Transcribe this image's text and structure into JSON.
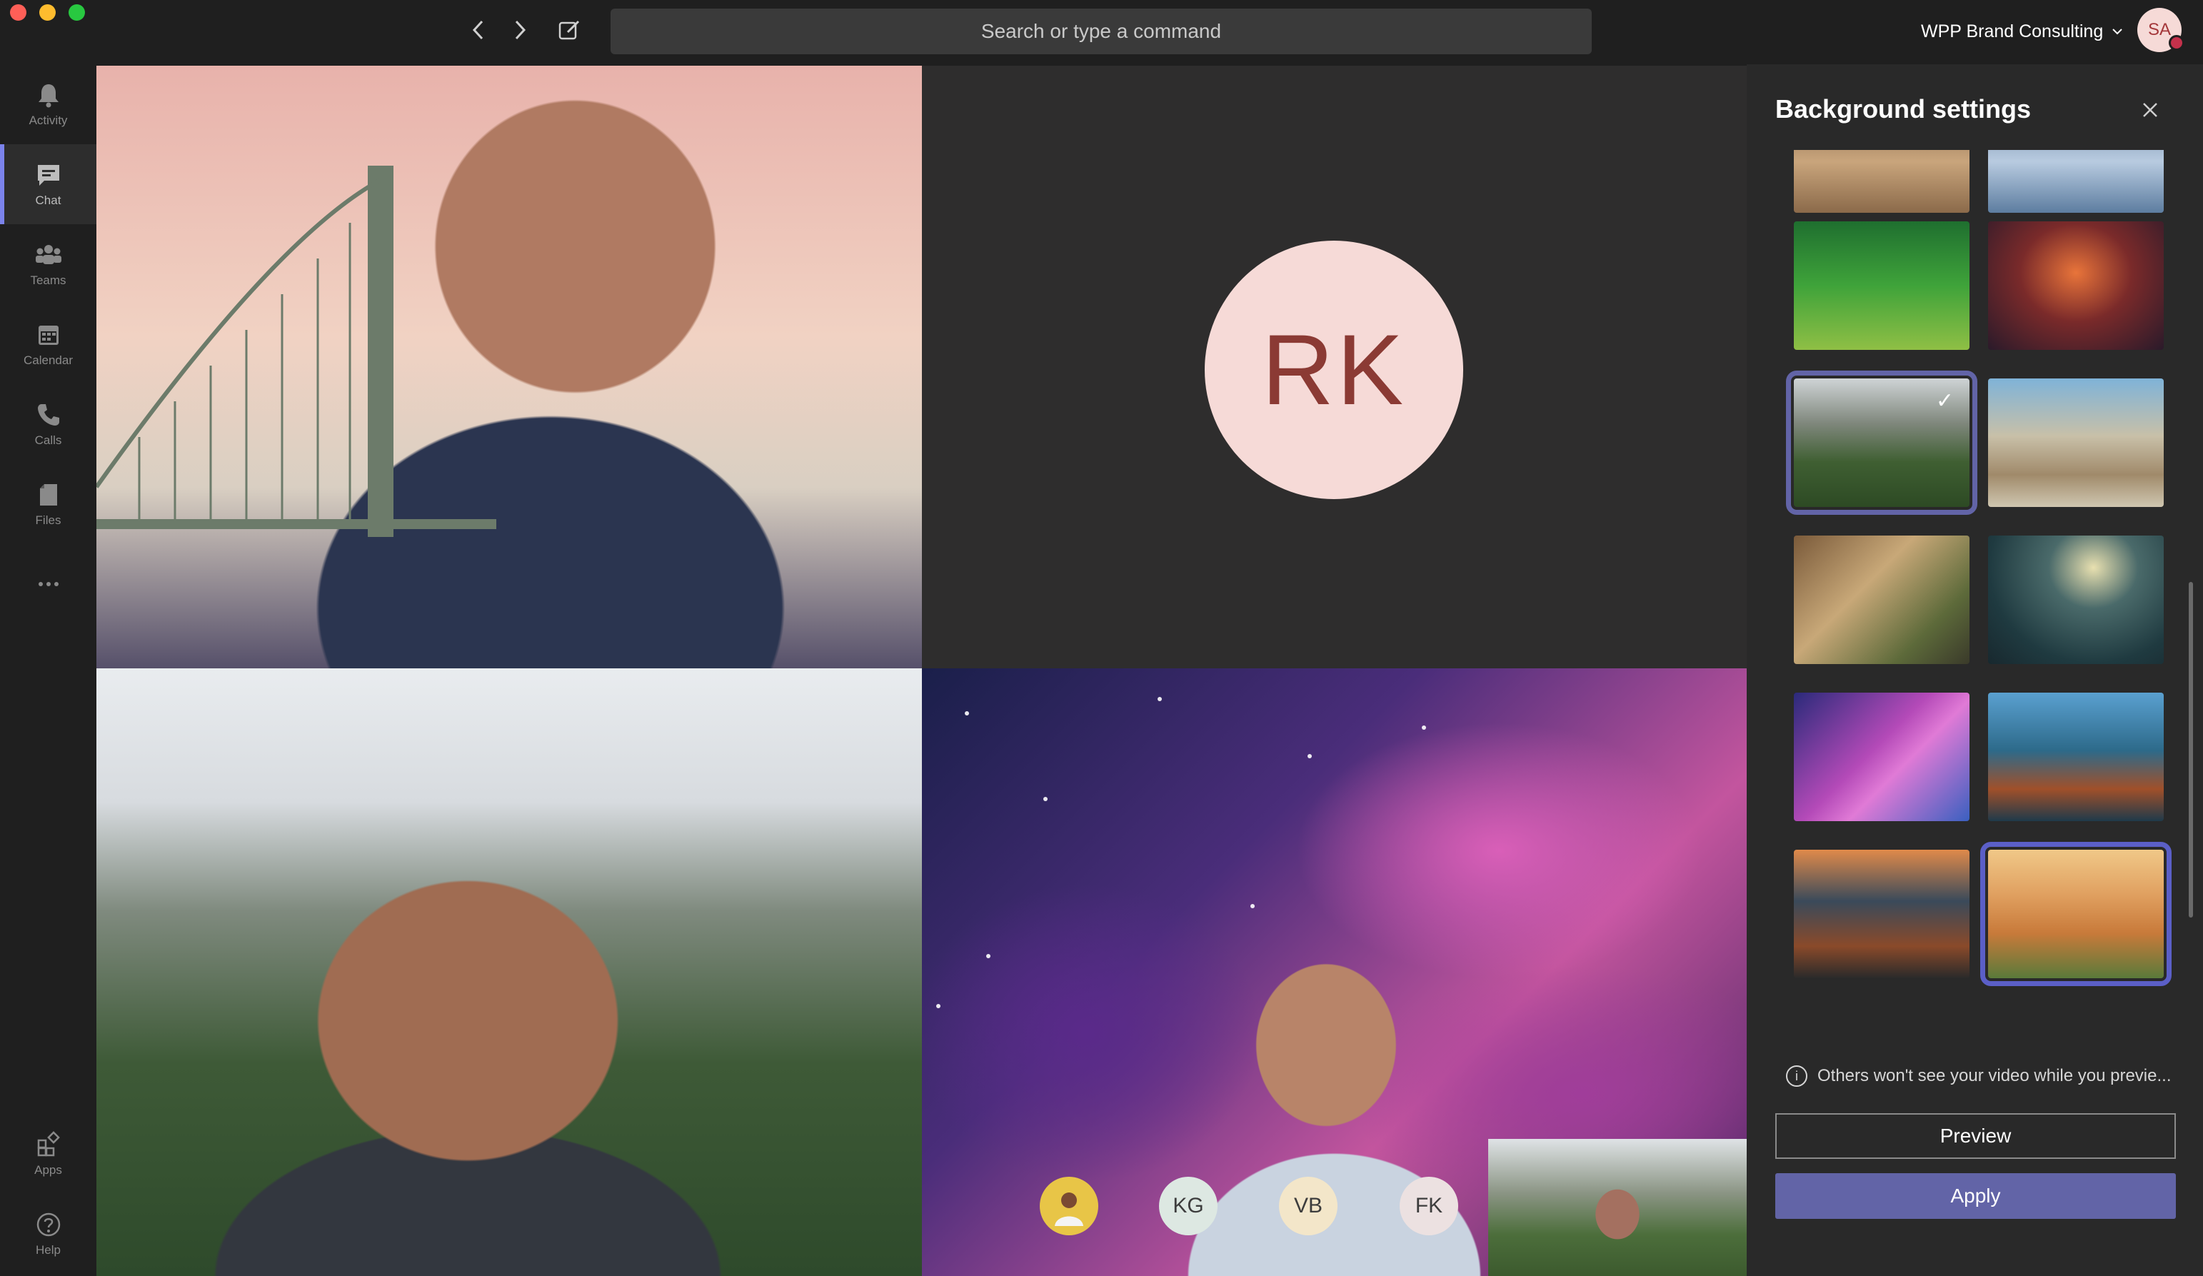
{
  "titlebar": {
    "search_placeholder": "Search or type a command",
    "org_name": "WPP Brand Consulting",
    "user_initials": "SA"
  },
  "rail": {
    "items": [
      {
        "label": "Activity",
        "icon": "bell-icon"
      },
      {
        "label": "Chat",
        "icon": "chat-icon",
        "active": true
      },
      {
        "label": "Teams",
        "icon": "teams-icon"
      },
      {
        "label": "Calendar",
        "icon": "calendar-icon"
      },
      {
        "label": "Calls",
        "icon": "phone-icon"
      },
      {
        "label": "Files",
        "icon": "file-icon"
      },
      {
        "label": "",
        "icon": "more-icon"
      }
    ],
    "bottom": [
      {
        "label": "Apps",
        "icon": "apps-icon"
      },
      {
        "label": "Help",
        "icon": "help-icon"
      }
    ]
  },
  "meeting": {
    "participant_rk_initials": "RK",
    "mini_avatars": [
      "",
      "KG",
      "VB",
      "FK"
    ]
  },
  "panel": {
    "title": "Background settings",
    "selected_index": 4,
    "info_text": "Others won't see your video while you previe...",
    "preview_label": "Preview",
    "apply_label": "Apply"
  },
  "colors": {
    "accent": "#6264a7",
    "app_bg": "#1f1f1f",
    "panel_bg": "#292929",
    "rk_avatar_bg": "#f6dad7"
  }
}
